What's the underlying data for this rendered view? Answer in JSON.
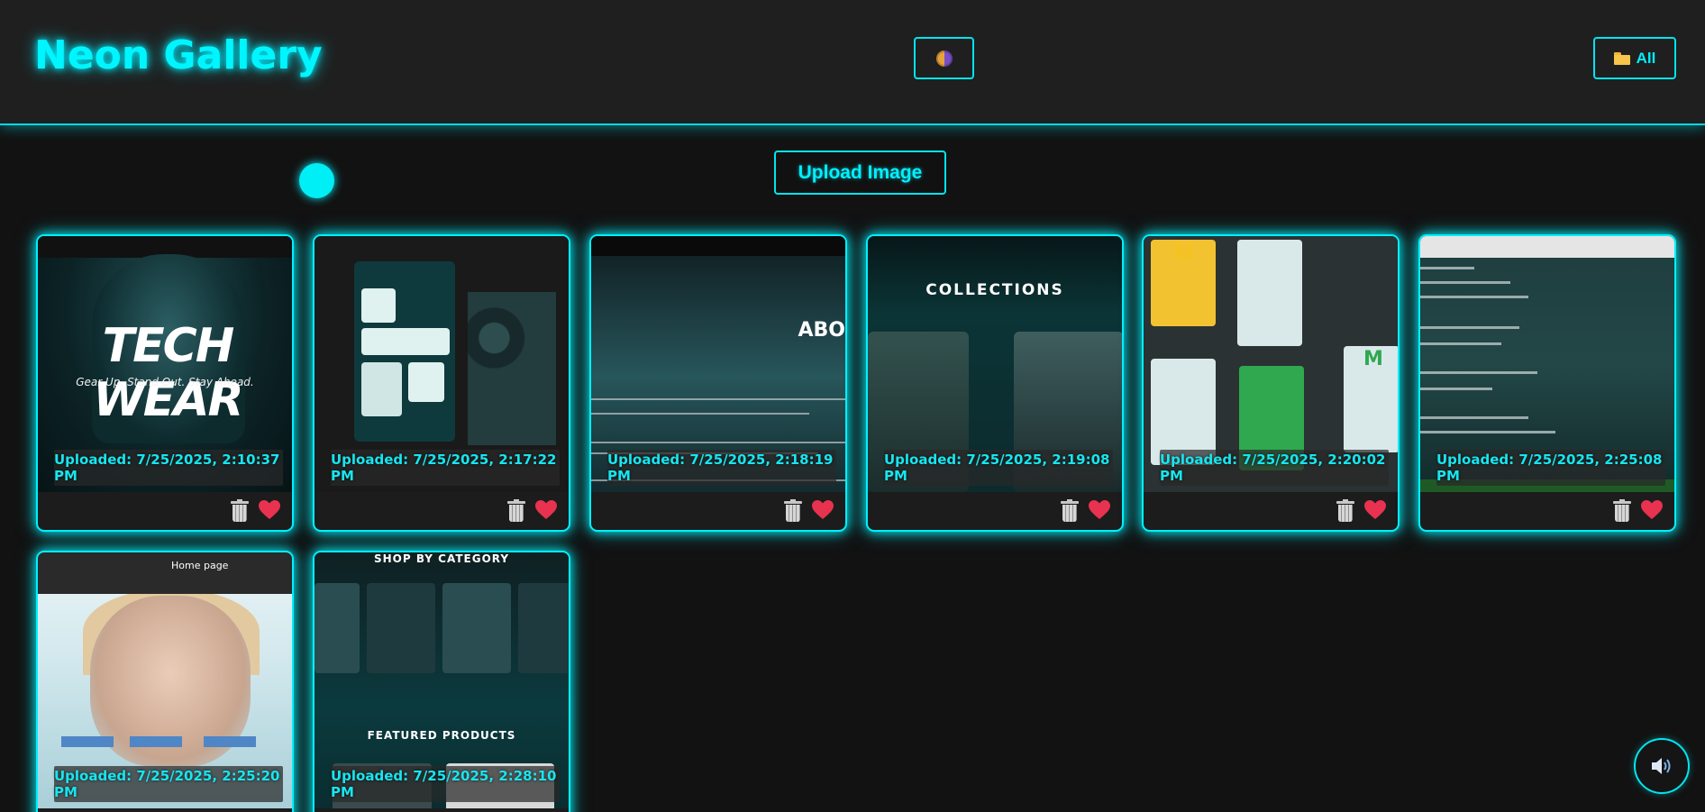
{
  "header": {
    "title": "Neon Gallery",
    "theme_icon": "palette-icon",
    "filter_label": "All",
    "filter_icon": "folder-icon"
  },
  "upload": {
    "label": "Upload Image"
  },
  "cards": [
    {
      "line1": "Uploaded: 7/25/2025, 2:10:37",
      "line2": "PM"
    },
    {
      "line1": "Uploaded: 7/25/2025, 2:17:22",
      "line2": "PM"
    },
    {
      "line1": "Uploaded: 7/25/2025, 2:18:19",
      "line2": "PM"
    },
    {
      "line1": "Uploaded: 7/25/2025, 2:19:08",
      "line2": "PM"
    },
    {
      "line1": "Uploaded: 7/25/2025, 2:20:02",
      "line2": "PM"
    },
    {
      "line1": "Uploaded: 7/25/2025, 2:25:08",
      "line2": "PM"
    },
    {
      "line1": "Uploaded: 7/25/2025, 2:25:20",
      "line2": "PM"
    },
    {
      "line1": "Uploaded: 7/25/2025, 2:28:10",
      "line2": "PM"
    }
  ],
  "thumbs": {
    "t1": {
      "word": "TECH WEAR",
      "tag": "Gear Up. Stand Out. Stay Ahead."
    },
    "t3": {
      "abo": "ABO"
    },
    "t4": {
      "title": "COLLECTIONS"
    },
    "t7": {
      "label": "Home page"
    },
    "t8": {
      "head": "SHOP BY CATEGORY",
      "featured": "FEATURED PRODUCTS"
    }
  },
  "icons": {
    "delete": "trash-icon",
    "favorite": "heart-icon",
    "sound": "speaker-icon"
  },
  "colors": {
    "accent": "#00f0ff",
    "background": "#121212",
    "header_bg": "#1f1f1f",
    "favorite": "#e8324f"
  }
}
